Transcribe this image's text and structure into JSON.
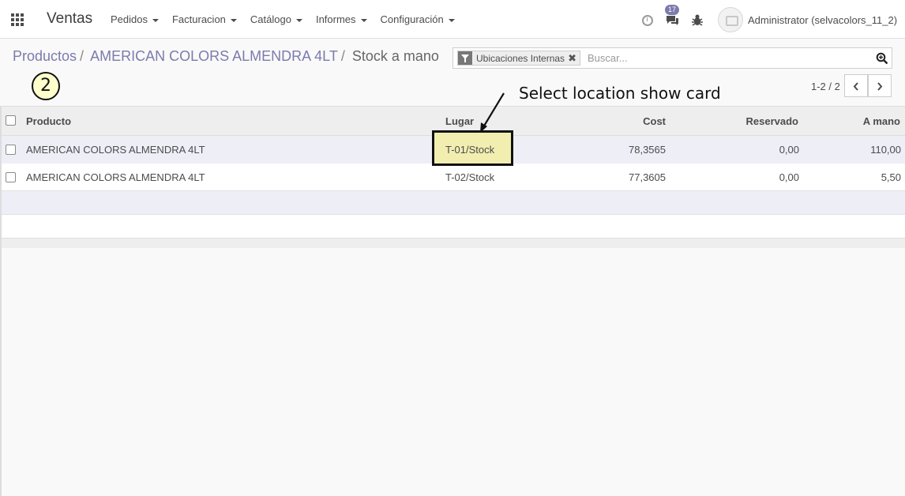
{
  "navbar": {
    "app_name": "Ventas",
    "menu": [
      {
        "label": "Pedidos"
      },
      {
        "label": "Facturacion"
      },
      {
        "label": "Catálogo"
      },
      {
        "label": "Informes"
      },
      {
        "label": "Configuración"
      }
    ],
    "chat_badge": "17",
    "user": "Administrator (selvacolors_11_2)"
  },
  "breadcrumb": {
    "items": [
      "Productos",
      "AMERICAN COLORS ALMENDRA 4LT"
    ],
    "separator": "/",
    "current": "Stock a mano"
  },
  "step_marker": "2",
  "search": {
    "facet_label": "Ubicaciones Internas",
    "facet_remove": "✖",
    "placeholder": "Buscar..."
  },
  "pager": {
    "value": "1-2 / 2"
  },
  "annotation": {
    "text": "Select location show card"
  },
  "table": {
    "columns": [
      "Producto",
      "Lugar",
      "Cost",
      "Reservado",
      "A mano"
    ],
    "rows": [
      {
        "producto": "AMERICAN COLORS ALMENDRA 4LT",
        "lugar": "T-01/Stock",
        "cost": "78,3565",
        "reservado": "0,00",
        "a_mano": "110,00"
      },
      {
        "producto": "AMERICAN COLORS ALMENDRA 4LT",
        "lugar": "T-02/Stock",
        "cost": "77,3605",
        "reservado": "0,00",
        "a_mano": "5,50"
      }
    ]
  },
  "colors": {
    "accent": "#7c7bad",
    "highlight": "#f2eeb0"
  }
}
